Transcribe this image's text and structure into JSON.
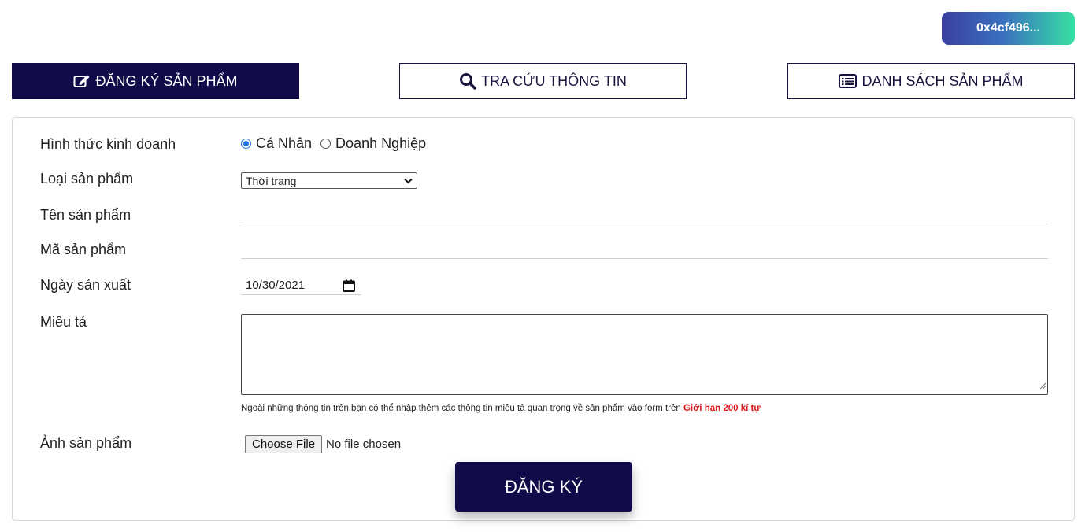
{
  "wallet": {
    "address": "0x4cf496..."
  },
  "tabs": [
    {
      "label": "ĐĂNG KÝ SẢN PHẨM",
      "icon": "edit-icon",
      "active": true
    },
    {
      "label": "TRA CỨU THÔNG TIN",
      "icon": "search-icon",
      "active": false
    },
    {
      "label": "DANH SÁCH SẢN PHẨM",
      "icon": "list-icon",
      "active": false
    }
  ],
  "form": {
    "business_type": {
      "label": "Hình thức kinh doanh",
      "options": [
        "Cá Nhân",
        "Doanh Nghiệp"
      ],
      "selected": "Cá Nhân"
    },
    "product_type": {
      "label": "Loại sản phẩm",
      "value": "Thời trang"
    },
    "product_name": {
      "label": "Tên sản phẩm",
      "value": ""
    },
    "product_code": {
      "label": "Mã sản phẩm",
      "value": ""
    },
    "manufacture_date": {
      "label": "Ngày sản xuất",
      "value": "10/30/2021"
    },
    "description": {
      "label": "Miêu tả",
      "value": "",
      "hint": "Ngoài những thông tin trên bạn có thể nhập thêm các thông tin miêu tả quan trọng về sản phẩm vào form trên",
      "limit": "Giới hạn 200 kí tự"
    },
    "image": {
      "label": "Ảnh sản phẩm",
      "button": "Choose File",
      "status": "No file chosen"
    },
    "submit_label": "ĐĂNG KÝ"
  },
  "colors": {
    "primary": "#120b4a",
    "accent_red": "#e01818",
    "radio_blue": "#1a73e8"
  }
}
